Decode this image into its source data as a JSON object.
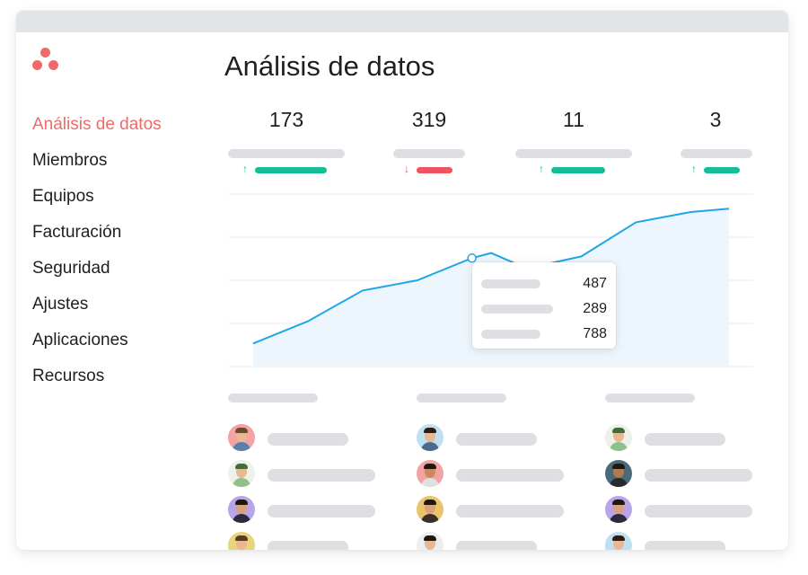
{
  "app": {
    "logo_icon": "asana-logo-icon",
    "brand_color": "#f06a6a"
  },
  "sidebar": {
    "items": [
      {
        "label": "Análisis de datos",
        "active": true
      },
      {
        "label": "Miembros"
      },
      {
        "label": "Equipos"
      },
      {
        "label": "Facturación"
      },
      {
        "label": "Seguridad"
      },
      {
        "label": "Ajustes"
      },
      {
        "label": "Aplicaciones"
      },
      {
        "label": "Recursos"
      }
    ]
  },
  "main": {
    "title": "Análisis de datos",
    "stats": [
      {
        "value": "173",
        "trend": "up",
        "trend_icon": "arrow-up-icon"
      },
      {
        "value": "319",
        "trend": "down",
        "trend_icon": "arrow-down-icon"
      },
      {
        "value": "11",
        "trend": "up",
        "trend_icon": "arrow-up-icon"
      },
      {
        "value": "3",
        "trend": "up",
        "trend_icon": "arrow-up-icon"
      }
    ],
    "trend_colors": {
      "up": "#14bf96",
      "down": "#f0535f"
    }
  },
  "chart_data": {
    "type": "area",
    "x": [
      0,
      1,
      2,
      3,
      4,
      4.35,
      5,
      6,
      7,
      8,
      8.7
    ],
    "series": [
      {
        "values": [
          26,
          52,
          88,
          100,
          126,
          132,
          114,
          128,
          168,
          180,
          184
        ]
      }
    ],
    "ylim": [
      0,
      200
    ],
    "grid": true,
    "line_color": "#1ea7e8",
    "fill_color": "#eef6fd",
    "highlighted_point_index": 4
  },
  "tooltip": {
    "values": [
      "487",
      "289",
      "788"
    ]
  },
  "people_lists": [
    {
      "avatars": [
        "avatar",
        "avatar",
        "avatar",
        "avatar"
      ]
    },
    {
      "avatars": [
        "avatar",
        "avatar",
        "avatar",
        "avatar"
      ]
    },
    {
      "avatars": [
        "avatar",
        "avatar",
        "avatar",
        "avatar"
      ]
    }
  ]
}
